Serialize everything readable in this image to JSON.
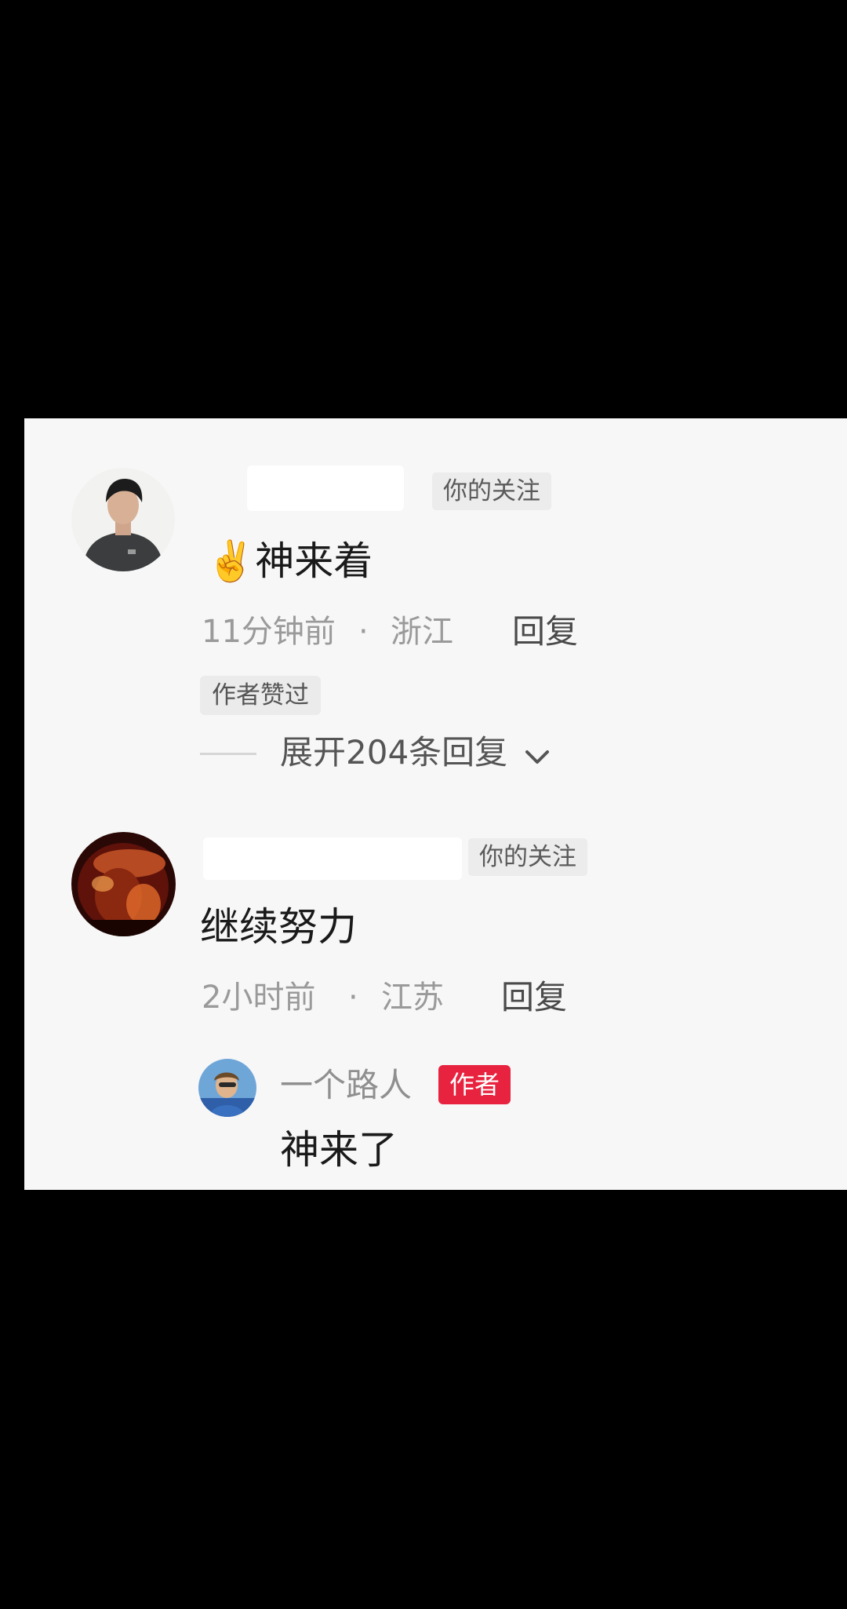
{
  "comments": [
    {
      "follow_tag": "你的关注",
      "emoji": "✌️",
      "text": "神来着",
      "time": "11分钟前",
      "separator": "·",
      "location": "浙江",
      "reply_label": "回复",
      "liked_badge": "作者赞过",
      "expand_label": "展开204条回复"
    },
    {
      "follow_tag": "你的关注",
      "text": "继续努力",
      "time": "2小时前",
      "separator": "·",
      "location": "江苏",
      "reply_label": "回复",
      "reply": {
        "username": "一个路人",
        "author_badge": "作者",
        "text": "神来了"
      }
    }
  ],
  "colors": {
    "author_badge": "#e8233f",
    "meta_text": "#9a9a9a",
    "panel_bg": "#f7f7f7"
  },
  "icons": [
    "chevron-down-icon"
  ]
}
